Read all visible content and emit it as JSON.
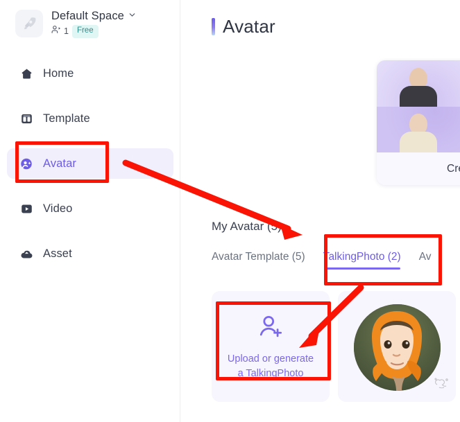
{
  "sidebar": {
    "workspace": {
      "logo_icon": "rocket-icon",
      "name": "Default Space",
      "chevron_icon": "chevron-down-icon",
      "members_icon": "members-icon",
      "member_count": "1",
      "plan_badge": "Free"
    },
    "items": [
      {
        "label": "Home",
        "icon": "home-icon",
        "active": false
      },
      {
        "label": "Template",
        "icon": "template-icon",
        "active": false
      },
      {
        "label": "Avatar",
        "icon": "avatar-icon",
        "active": true
      },
      {
        "label": "Video",
        "icon": "video-icon",
        "active": false
      },
      {
        "label": "Asset",
        "icon": "asset-cloud-icon",
        "active": false
      }
    ]
  },
  "main": {
    "page_title": "Avatar",
    "promo_card": {
      "footer_label": "Creat",
      "thumbnails": [
        "avatar-thumb-1",
        "avatar-thumb-2",
        "avatar-thumb-3",
        "avatar-thumb-4"
      ]
    },
    "section_title": "My Avatar (5)",
    "tabs": [
      {
        "label": "Avatar Template (5)",
        "active": false
      },
      {
        "label": "TalkingPhoto (2)",
        "active": true
      },
      {
        "label": "Av",
        "active": false
      }
    ],
    "cards": [
      {
        "type": "upload",
        "icon": "user-plus-icon",
        "label_line1": "Upload or generate",
        "label_line2": "a TalkingPhoto"
      },
      {
        "type": "photo",
        "alt": "baby-in-orange-robe-photo",
        "watermark": "watermark-mark"
      }
    ]
  },
  "annotations": {
    "boxes": [
      {
        "name": "avatar-nav-highlight-box"
      },
      {
        "name": "talkingphoto-tab-highlight-box"
      },
      {
        "name": "upload-card-highlight-box"
      }
    ],
    "arrows": [
      {
        "name": "arrow-avatar-to-my-avatar"
      },
      {
        "name": "arrow-tab-to-upload-card"
      }
    ],
    "color": "#fa1405"
  },
  "colors": {
    "accent_purple": "#6c5ce7",
    "accent_purple_light": "#7a68ee",
    "sidebar_active_bg": "#f1effc",
    "badge_bg": "#dff6f5",
    "badge_text": "#2e8c88",
    "annotation_red": "#fa1405",
    "card_bg": "#f7f5fd"
  }
}
